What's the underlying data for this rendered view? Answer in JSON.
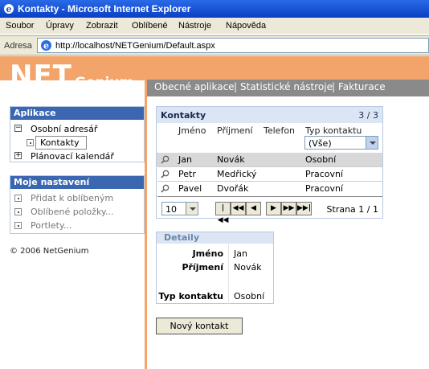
{
  "window": {
    "title": "Kontakty - Microsoft Internet Explorer"
  },
  "menu": [
    "Soubor",
    "Úpravy",
    "Zobrazit",
    "Oblíbené",
    "Nástroje",
    "Nápověda"
  ],
  "address": {
    "label": "Adresa",
    "url": "http://localhost/NETGenium/Default.aspx"
  },
  "logo": {
    "main": "NET",
    "sub": "Genium"
  },
  "topnav": [
    "Obecné aplikace",
    "Statistické nástroje",
    "Fakturace"
  ],
  "apps_panel": {
    "title": "Aplikace",
    "items": [
      "Osobní adresář",
      "Kontakty",
      "Plánovací kalendář"
    ]
  },
  "settings_panel": {
    "title": "Moje nastavení",
    "items": [
      "Přidat k oblíbeným",
      "Oblíbené položky...",
      "Portlety..."
    ]
  },
  "copyright": "© 2006 NetGenium",
  "grid": {
    "title": "Kontakty",
    "count": "3 / 3",
    "columns": [
      "Jméno",
      "Příjmení",
      "Telefon",
      "Typ kontaktu"
    ],
    "filter_value": "(Vše)",
    "rows": [
      {
        "jmeno": "Jan",
        "prijmeni": "Novák",
        "telefon": "",
        "typ": "Osobní"
      },
      {
        "jmeno": "Petr",
        "prijmeni": "Medřický",
        "telefon": "",
        "typ": "Pracovní"
      },
      {
        "jmeno": "Pavel",
        "prijmeni": "Dvořák",
        "telefon": "",
        "typ": "Pracovní"
      }
    ],
    "page_size": "10",
    "page_info": "Strana 1 / 1"
  },
  "detail": {
    "title": "Detaily",
    "fields": [
      {
        "label": "Jméno",
        "value": "Jan"
      },
      {
        "label": "Příjmení",
        "value": "Novák"
      },
      {
        "label": "Typ kontaktu",
        "value": "Osobní"
      }
    ]
  },
  "new_button": "Nový kontakt",
  "colors": {
    "accent": "#f3a46a",
    "panel_header": "#3b66b0",
    "nav_bg": "#8a8a8a"
  }
}
